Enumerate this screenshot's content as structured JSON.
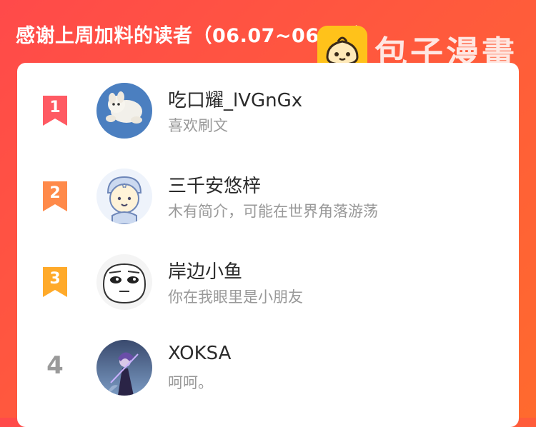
{
  "header": {
    "title": "感谢上周加料的读者（06.07~06.13）"
  },
  "watermark": {
    "text": "包子漫畫",
    "logo_icon": "bun-logo-icon",
    "logo_color": "#ffc21a"
  },
  "colors": {
    "background": "#ff4a4a",
    "rank1": "#ff5a63",
    "rank2": "#ff8a4a",
    "rank3": "#ffaa2a",
    "rank_plain": "#9a9a9a"
  },
  "readers": [
    {
      "rank": "1",
      "name": "吃口耀_lVGnGx",
      "description": "喜欢刷文",
      "avatar_icon": "cat-avatar-icon"
    },
    {
      "rank": "2",
      "name": "三千安悠梓",
      "description": "木有简介，可能在世界角落游荡",
      "avatar_icon": "cartoon-kid-avatar-icon"
    },
    {
      "rank": "3",
      "name": "岸边小鱼",
      "description": "你在我眼里是小朋友",
      "avatar_icon": "meme-face-avatar-icon"
    },
    {
      "rank": "4",
      "name": "XOKSA",
      "description": "呵呵。",
      "avatar_icon": "game-character-avatar-icon"
    }
  ]
}
